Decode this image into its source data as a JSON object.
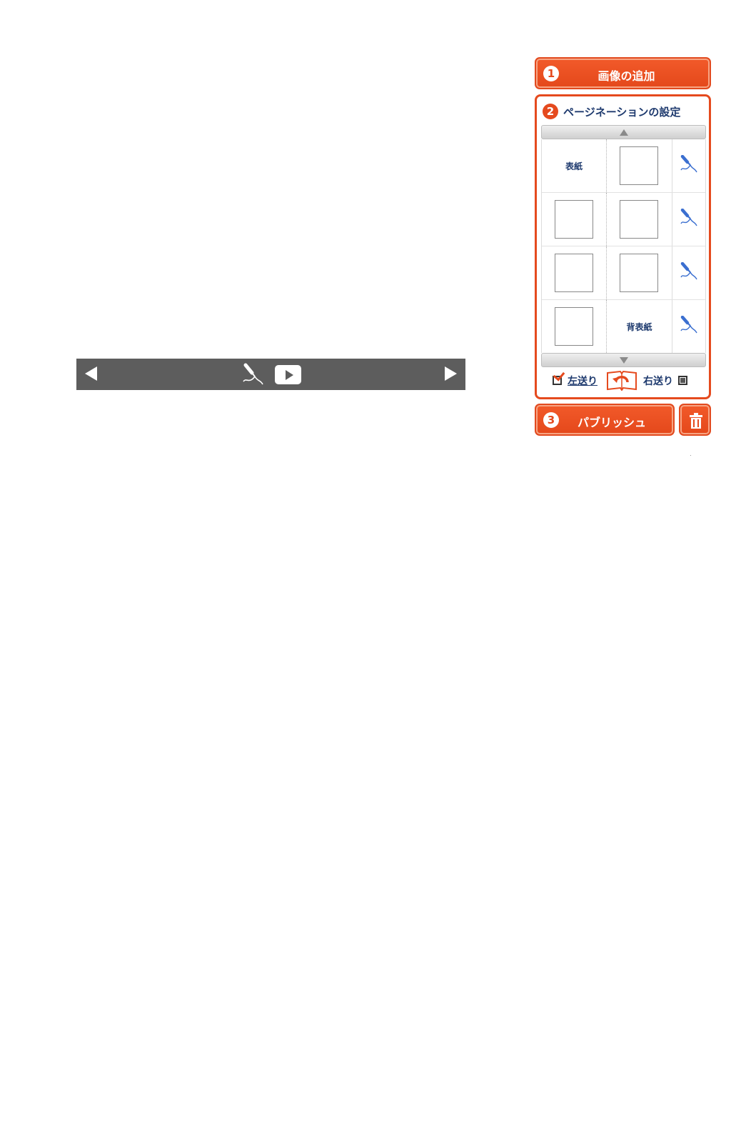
{
  "player": {
    "prev_icon": "triangle-left-icon",
    "next_icon": "triangle-right-icon",
    "mic_icon": "microphone-icon",
    "play_icon": "play-icon"
  },
  "steps": {
    "add_images": {
      "number": "1",
      "label": "画像の追加"
    },
    "pagination": {
      "number": "2",
      "title": "ページネーションの設定"
    },
    "publish": {
      "number": "3",
      "label": "パブリッシュ"
    }
  },
  "pagination": {
    "scroll_up_icon": "triangle-up-icon",
    "scroll_down_icon": "triangle-down-icon",
    "rows": [
      {
        "left": "表紙",
        "right": "",
        "mic_icon": "microphone-icon"
      },
      {
        "left": "",
        "right": "",
        "mic_icon": "microphone-icon"
      },
      {
        "left": "",
        "right": "",
        "mic_icon": "microphone-icon"
      },
      {
        "left": "",
        "right": "背表紙",
        "mic_icon": "microphone-icon"
      }
    ],
    "direction": {
      "left_label": "左送り",
      "right_label": "右送り",
      "left_checked": true,
      "right_checked": false,
      "book_icon": "book-flip-icon"
    }
  },
  "trash_icon": "trash-icon",
  "colors": {
    "accent": "#e54a1e",
    "text": "#1e3a6e",
    "player_bar": "#5d5d5d",
    "mic_blue": "#3b6fd0"
  }
}
